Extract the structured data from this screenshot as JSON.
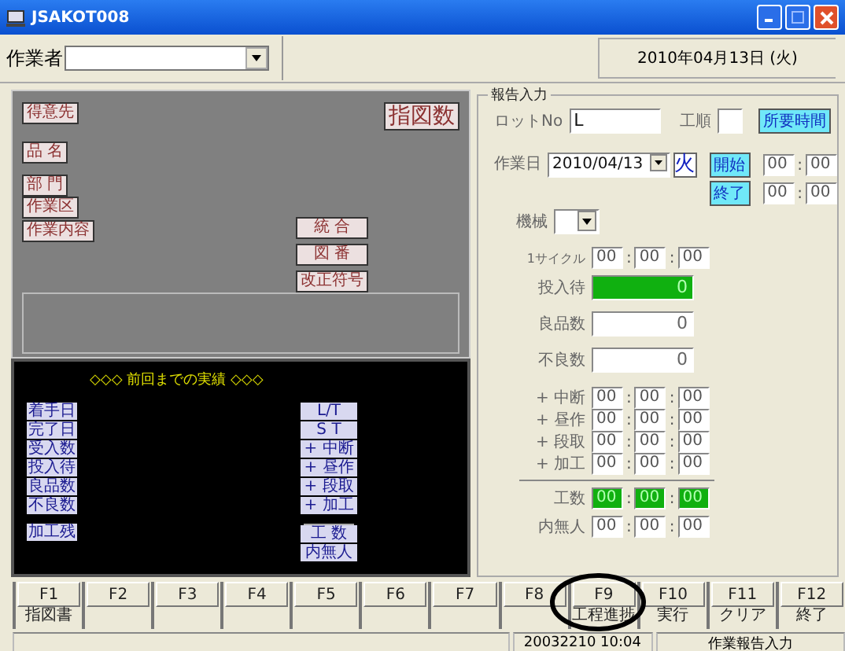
{
  "window": {
    "title": "JSAKOT008"
  },
  "toolbar": {
    "worker_label": "作業者",
    "date": "2010年04月13日 (火)"
  },
  "info_panel": {
    "left_labels": [
      "得意先",
      "品 名",
      "部 門",
      "作業区",
      "作業内容"
    ],
    "count_label": "指図数",
    "mid_labels": [
      "統 合",
      "図 番",
      "改正符号"
    ]
  },
  "history": {
    "title": "◇◇◇  前回までの実績  ◇◇◇",
    "left_labels": [
      "着手日",
      "完了日",
      "受入数",
      "投入待",
      "良品数",
      "不良数",
      "加工残"
    ],
    "right_labels": [
      "L/T",
      "S T",
      "+ 中断",
      "+ 昼作",
      "+ 段取",
      "+ 加工",
      "工 数",
      "内無人"
    ]
  },
  "report": {
    "title": "報告入力",
    "lot_label": "ロットNo",
    "lot_value": "L",
    "process_label": "工順",
    "required_time_button": "所要時間",
    "work_date_label": "作業日",
    "work_date": "2010/04/13",
    "weekday": "火",
    "start_button": "開始",
    "start_time": [
      "00",
      "00"
    ],
    "end_button": "終了",
    "end_time": [
      "00",
      "00"
    ],
    "separator": ":",
    "machine_label": "機械",
    "cycle_label": "1サイクル",
    "cycle": [
      "00",
      "00",
      "00"
    ],
    "counts": [
      {
        "label": "投入待",
        "value": "0",
        "highlight": true
      },
      {
        "label": "良品数",
        "value": "0",
        "highlight": false
      },
      {
        "label": "不良数",
        "value": "0",
        "highlight": false
      }
    ],
    "times": [
      {
        "label": "+ 中断",
        "values": [
          "00",
          "00",
          "00"
        ],
        "highlight": false
      },
      {
        "label": "+ 昼作",
        "values": [
          "00",
          "00",
          "00"
        ],
        "highlight": false
      },
      {
        "label": "+ 段取",
        "values": [
          "00",
          "00",
          "00"
        ],
        "highlight": false
      },
      {
        "label": "+ 加工",
        "values": [
          "00",
          "00",
          "00"
        ],
        "highlight": false
      },
      {
        "label": "工数",
        "values": [
          "00",
          "00",
          "00"
        ],
        "highlight": true
      },
      {
        "label": "内無人",
        "values": [
          "00",
          "00",
          "00"
        ],
        "highlight": false
      }
    ]
  },
  "function_keys": [
    {
      "key": "F1",
      "caption": "指図書"
    },
    {
      "key": "F2"
    },
    {
      "key": "F3"
    },
    {
      "key": "F4"
    },
    {
      "key": "F5"
    },
    {
      "key": "F6"
    },
    {
      "key": "F7"
    },
    {
      "key": "F8"
    },
    {
      "key": "F9",
      "caption": "工程進捗"
    },
    {
      "key": "F10",
      "caption": "実行"
    },
    {
      "key": "F11",
      "caption": "クリア"
    },
    {
      "key": "F12",
      "caption": "終了"
    }
  ],
  "status_bar": [
    "20032210 10:04",
    "作業報告入力"
  ]
}
